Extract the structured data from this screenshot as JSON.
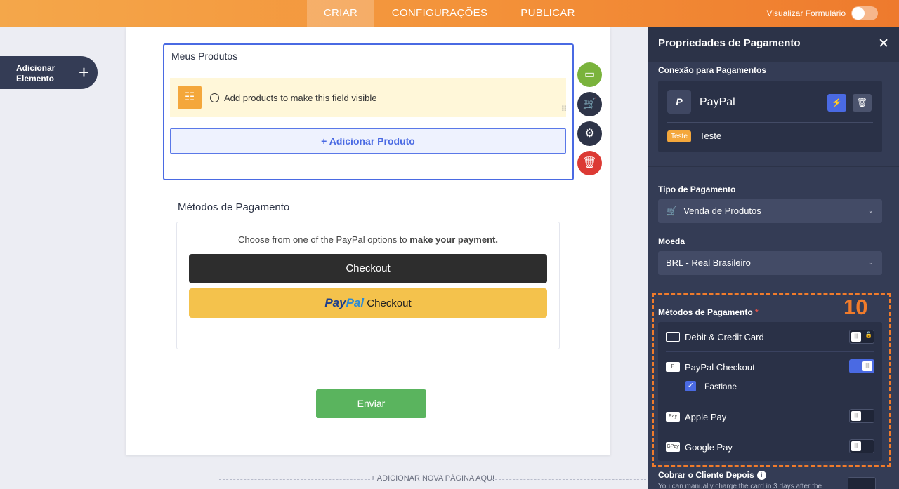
{
  "topbar": {
    "tabs": [
      "CRIAR",
      "CONFIGURAÇÕES",
      "PUBLICAR"
    ],
    "preview_label": "Visualizar Formulário"
  },
  "left": {
    "add_element": "Adicionar Elemento"
  },
  "form": {
    "products_title": "Meus Produtos",
    "notice": "Add products to make this field visible",
    "add_product": "+ Adicionar Produto",
    "payment_title": "Métodos de Pagamento",
    "payment_desc_plain": "Choose from one of the PayPal options to ",
    "payment_desc_bold": "make your payment.",
    "checkout_label": "Checkout",
    "paypal_brand_1": "Pay",
    "paypal_brand_2": "Pal",
    "paypal_checkout_label": "Checkout",
    "submit": "Enviar",
    "add_page": "+ ADICIONAR NOVA PÁGINA AQUI"
  },
  "panel": {
    "title": "Propriedades de Pagamento",
    "connection_label": "Conexão para Pagamentos",
    "gateway_name": "PayPal",
    "mode_badge": "Teste",
    "mode_text": "Teste",
    "payment_type_label": "Tipo de Pagamento",
    "payment_type_value": "Venda de Produtos",
    "currency_label": "Moeda",
    "currency_value": "BRL - Real Brasileiro",
    "methods_label": "Métodos de Pagamento",
    "required_mark": "*",
    "step_number": "10",
    "methods": [
      {
        "name": "Debit & Credit Card",
        "enabled": false,
        "locked": true
      },
      {
        "name": "PayPal Checkout",
        "enabled": true
      },
      {
        "name": "Apple Pay",
        "enabled": false
      },
      {
        "name": "Google Pay",
        "enabled": false
      }
    ],
    "fastlane_label": "Fastlane",
    "fastlane_checked": true,
    "charge_later_label": "Cobrar o Cliente Depois",
    "charge_later_desc": "You can manually charge the card in 3 days after the"
  },
  "colors": {
    "accent": "#f39139",
    "highlight": "#f07b2b",
    "primary": "#4a6ae3",
    "submit": "#5ab45e"
  }
}
